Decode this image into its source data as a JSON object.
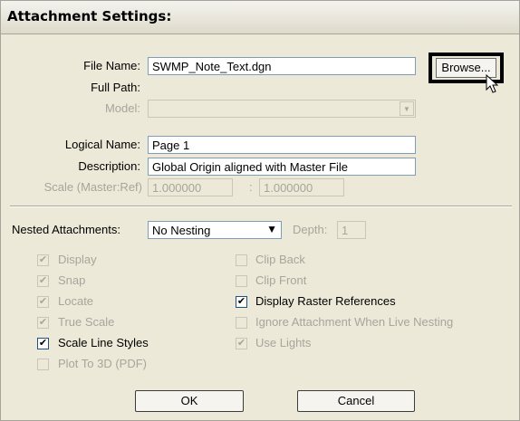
{
  "title": "Attachment Settings:",
  "file_name": {
    "label": "File Name:",
    "value": "SWMP_Note_Text.dgn",
    "browse_label": "Browse..."
  },
  "full_path": {
    "label": "Full Path:"
  },
  "model": {
    "label": "Model:",
    "value": ""
  },
  "logical_name": {
    "label": "Logical Name:",
    "value": "Page 1"
  },
  "description": {
    "label": "Description:",
    "value": "Global Origin aligned with Master File"
  },
  "scale": {
    "label": "Scale (Master:Ref)",
    "master": "1.000000",
    "separator": ":",
    "ref": "1.000000"
  },
  "nested": {
    "label": "Nested Attachments:",
    "value": "No Nesting",
    "depth_label": "Depth:",
    "depth_value": "1"
  },
  "options": {
    "display": {
      "label": "Display",
      "checked": "✔",
      "enabled": false
    },
    "snap": {
      "label": "Snap",
      "checked": "✔",
      "enabled": false
    },
    "locate": {
      "label": "Locate",
      "checked": "✔",
      "enabled": false
    },
    "true_scale": {
      "label": "True Scale",
      "checked": "✔",
      "enabled": false
    },
    "scale_line_styles": {
      "label": "Scale Line Styles",
      "checked": "✔",
      "enabled": true
    },
    "plot_to_3d": {
      "label": "Plot To 3D (PDF)",
      "checked": "",
      "enabled": false
    },
    "clip_back": {
      "label": "Clip Back",
      "checked": "",
      "enabled": false
    },
    "clip_front": {
      "label": "Clip Front",
      "checked": "",
      "enabled": false
    },
    "display_raster": {
      "label": "Display Raster References",
      "checked": "✔",
      "enabled": true
    },
    "ignore_attachment": {
      "label": "Ignore Attachment When Live Nesting",
      "checked": "",
      "enabled": false
    },
    "use_lights": {
      "label": "Use Lights",
      "checked": "✔",
      "enabled": false
    }
  },
  "buttons": {
    "ok": "OK",
    "cancel": "Cancel"
  },
  "icons": {
    "cursor": "mouse-pointer-icon",
    "dropdown": "chevron-down-icon"
  }
}
